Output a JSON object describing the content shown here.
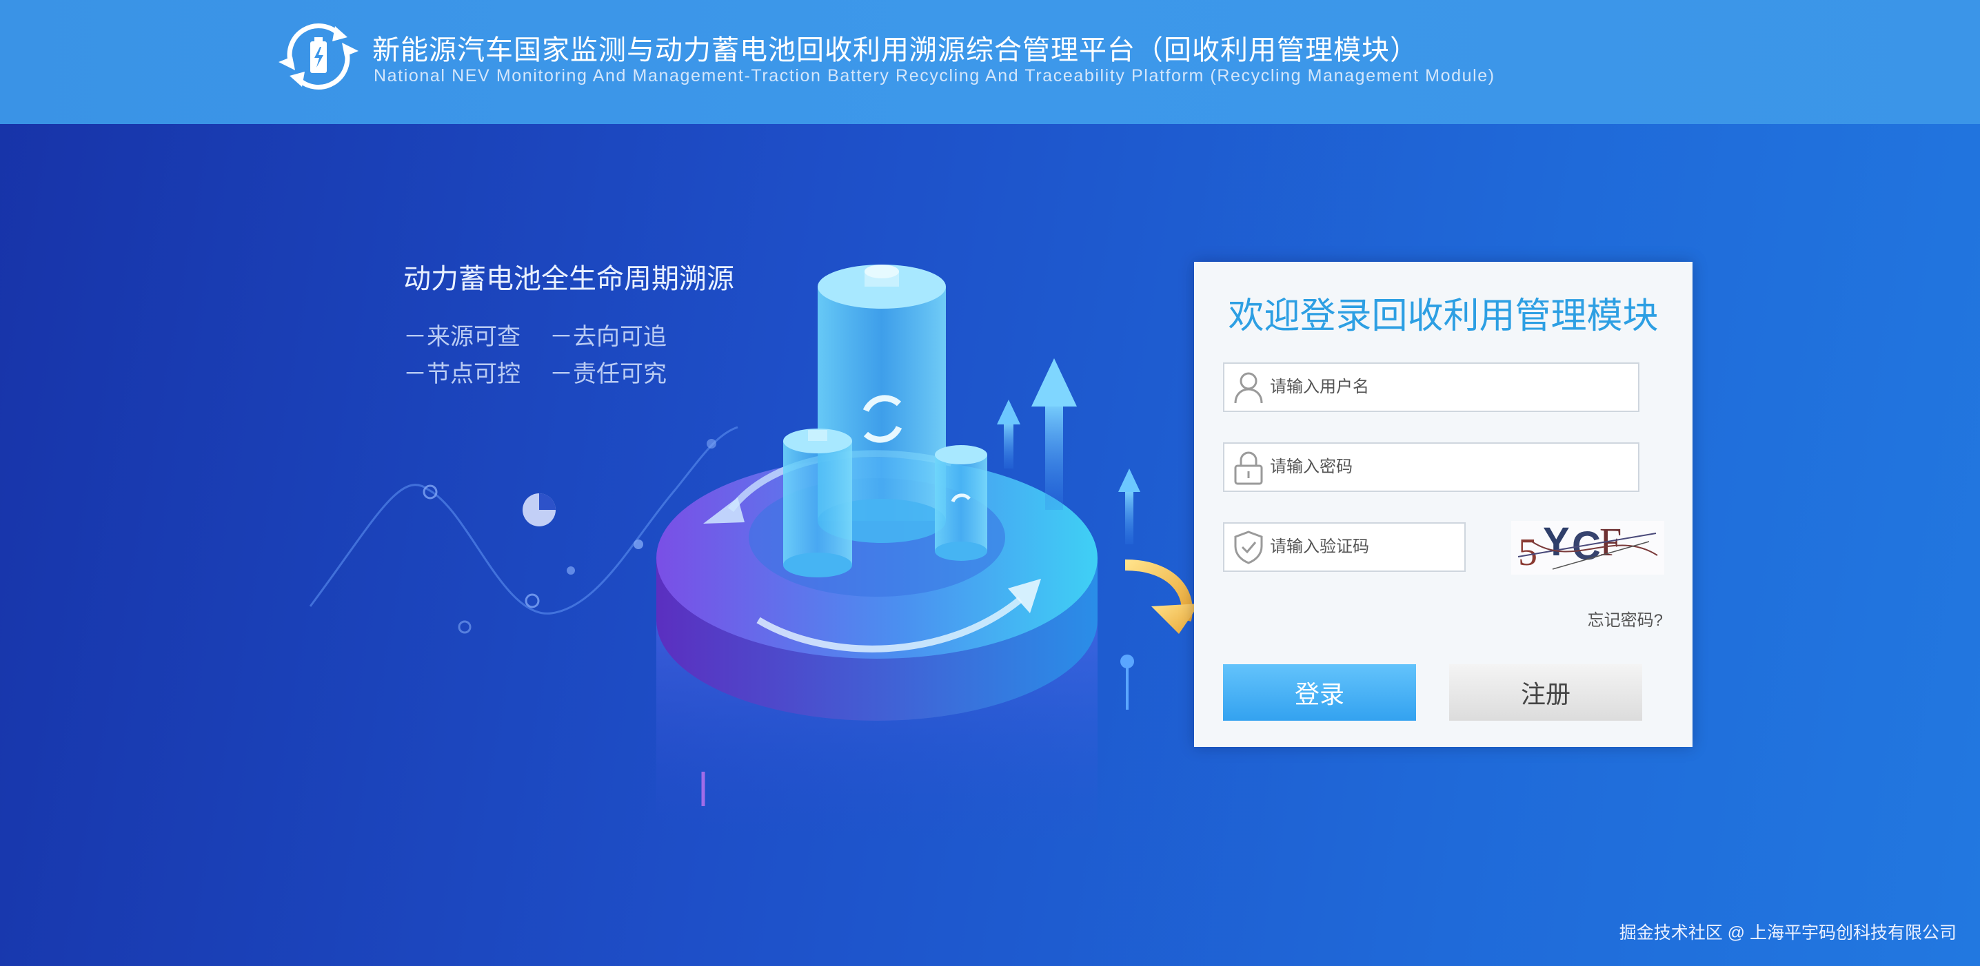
{
  "header": {
    "title_cn": "新能源汽车国家监测与动力蓄电池回收利用溯源综合管理平台（回收利用管理模块）",
    "title_en": "National NEV Monitoring And Management-Traction Battery Recycling And Traceability Platform (Recycling Management Module)",
    "logo_icon": "battery-recycle-icon"
  },
  "promo": {
    "title": "动力蓄电池全生命周期溯源",
    "items": [
      "－来源可查",
      "－去向可追",
      "－节点可控",
      "－责任可究"
    ]
  },
  "login": {
    "title": "欢迎登录回收利用管理模块",
    "username_placeholder": "请输入用户名",
    "password_placeholder": "请输入密码",
    "captcha_placeholder": "请输入验证码",
    "captcha_text": "5YCF",
    "forgot_label": "忘记密码?",
    "login_label": "登录",
    "register_label": "注册",
    "icons": {
      "username": "user-icon",
      "password": "lock-icon",
      "captcha": "shield-check-icon"
    }
  },
  "footer": {
    "text": "掘金技术社区 @ 上海平宇码创科技有限公司"
  },
  "colors": {
    "header_bg": "#3b95e8",
    "accent": "#2d9fe3",
    "login_button": "#33a2f0",
    "background": "#1e4fc8"
  }
}
